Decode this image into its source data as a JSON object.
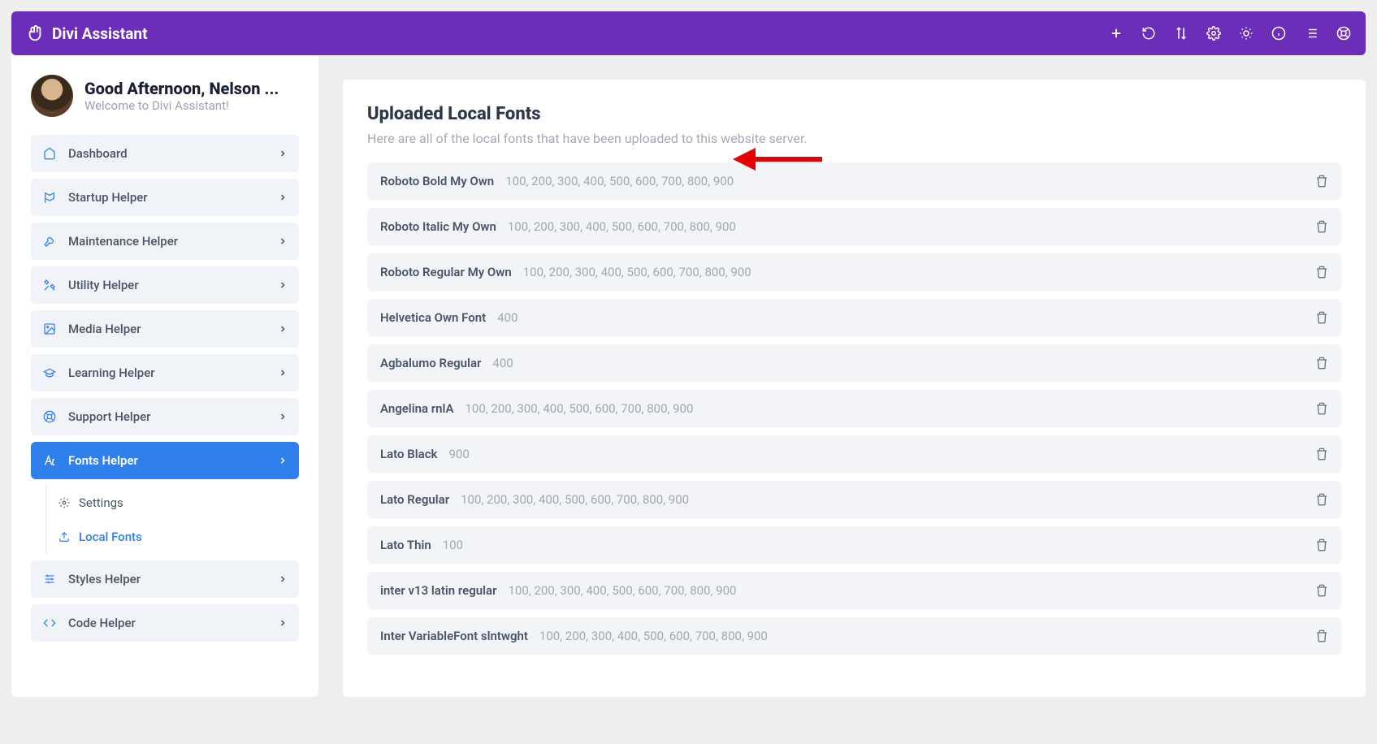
{
  "brand": "Divi Assistant",
  "profile": {
    "greeting": "Good Afternoon, Nelson ...",
    "welcome": "Welcome to Divi Assistant!"
  },
  "nav": [
    {
      "label": "Dashboard",
      "icon": "home"
    },
    {
      "label": "Startup Helper",
      "icon": "flag"
    },
    {
      "label": "Maintenance Helper",
      "icon": "wrench"
    },
    {
      "label": "Utility Helper",
      "icon": "tools"
    },
    {
      "label": "Media Helper",
      "icon": "image"
    },
    {
      "label": "Learning Helper",
      "icon": "grad"
    },
    {
      "label": "Support Helper",
      "icon": "life"
    },
    {
      "label": "Fonts Helper",
      "icon": "font",
      "active": true
    },
    {
      "label": "Styles Helper",
      "icon": "sliders"
    },
    {
      "label": "Code Helper",
      "icon": "code"
    }
  ],
  "subnav": [
    {
      "label": "Settings",
      "icon": "gear"
    },
    {
      "label": "Local Fonts",
      "icon": "upload",
      "active": true
    }
  ],
  "main": {
    "title": "Uploaded Local Fonts",
    "subtitle": "Here are all of the local fonts that have been uploaded to this website server."
  },
  "fonts": [
    {
      "name": "Roboto Bold My Own",
      "weights": "100, 200, 300, 400, 500, 600, 700, 800, 900"
    },
    {
      "name": "Roboto Italic My Own",
      "weights": "100, 200, 300, 400, 500, 600, 700, 800, 900"
    },
    {
      "name": "Roboto Regular My Own",
      "weights": "100, 200, 300, 400, 500, 600, 700, 800, 900"
    },
    {
      "name": "Helvetica Own Font",
      "weights": "400"
    },
    {
      "name": "Agbalumo Regular",
      "weights": "400"
    },
    {
      "name": "Angelina rnlA",
      "weights": "100, 200, 300, 400, 500, 600, 700, 800, 900"
    },
    {
      "name": "Lato Black",
      "weights": "900"
    },
    {
      "name": "Lato Regular",
      "weights": "100, 200, 300, 400, 500, 600, 700, 800, 900"
    },
    {
      "name": "Lato Thin",
      "weights": "100"
    },
    {
      "name": "inter v13 latin regular",
      "weights": "100, 200, 300, 400, 500, 600, 700, 800, 900"
    },
    {
      "name": "Inter VariableFont slntwght",
      "weights": "100, 200, 300, 400, 500, 600, 700, 800, 900"
    }
  ]
}
